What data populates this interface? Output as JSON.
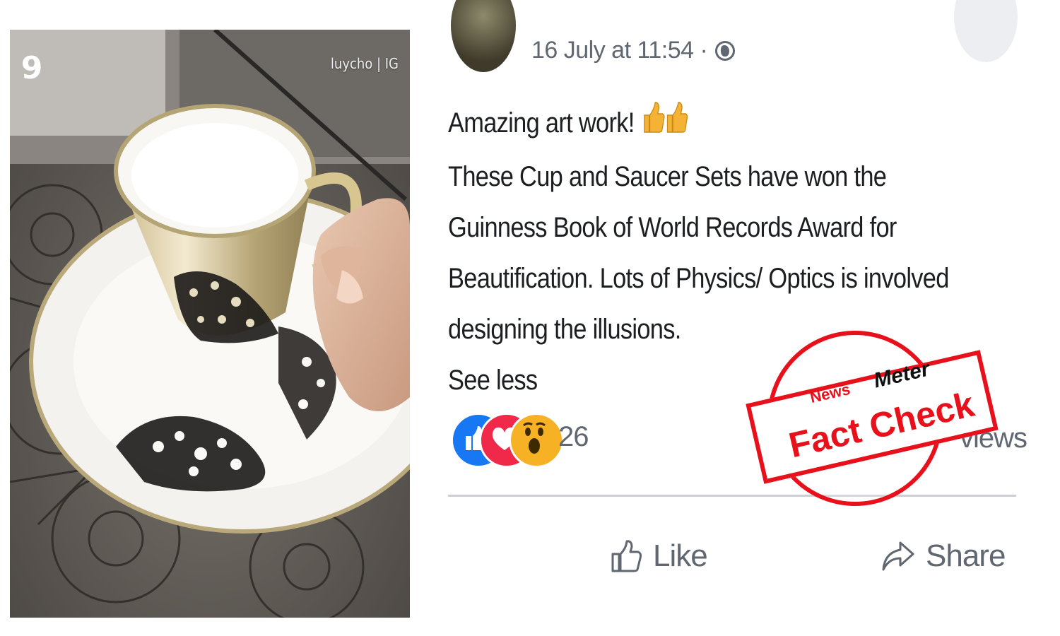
{
  "video": {
    "channel_logo": "9",
    "credit": "luycho | IG"
  },
  "post": {
    "timestamp": "16 July at 11:54 ·",
    "privacy_icon": "globe-icon",
    "text_lines": [
      "Amazing art work!",
      "These Cup and Saucer Sets have won the",
      "Guinness Book of World Records Award for",
      "Beautification. Lots of Physics/ Optics is involved",
      "designing the illusions."
    ],
    "see_less": "See less",
    "reactions": {
      "icons": [
        "like-reaction-icon",
        "love-reaction-icon",
        "wow-reaction-icon"
      ],
      "count": "26"
    },
    "views_fragment": "views",
    "actions": {
      "like": "Like",
      "share": "Share"
    }
  },
  "stamp": {
    "brand_news": "News",
    "brand_meter": "Meter",
    "label": "Fact Check"
  },
  "colors": {
    "stamp_red": "#e8101a",
    "like_blue": "#1877f2",
    "love_red": "#f02849",
    "wow_yellow": "#f7b125",
    "secondary_text": "#606770"
  }
}
